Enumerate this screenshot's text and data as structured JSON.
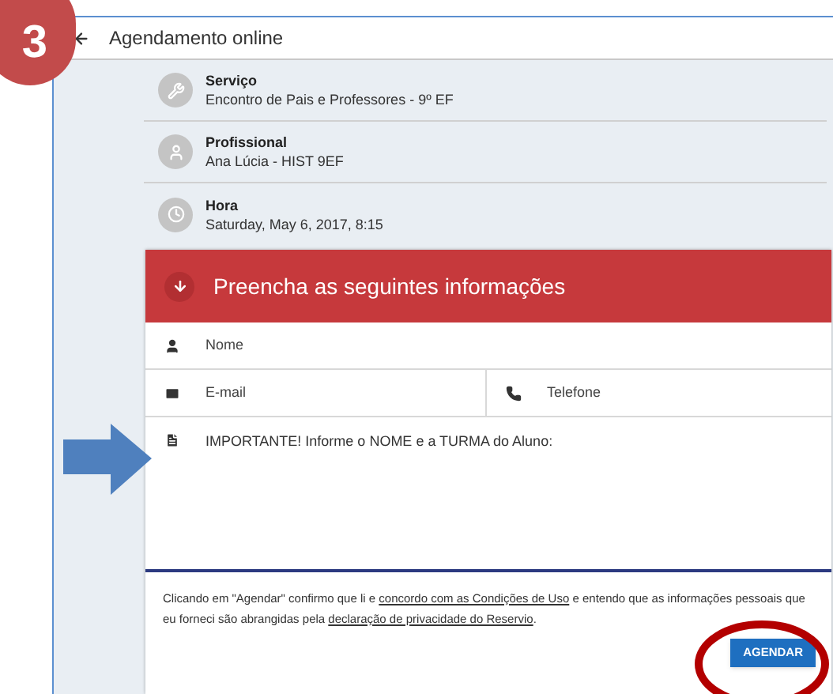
{
  "step_badge": "3",
  "header": {
    "title": "Agendamento online"
  },
  "summary": [
    {
      "kind": "service",
      "label": "Serviço",
      "value": "Encontro de Pais e Professores - 9º EF"
    },
    {
      "kind": "professional",
      "label": "Profissional",
      "value": "Ana Lúcia - HIST 9EF"
    },
    {
      "kind": "time",
      "label": "Hora",
      "value": "Saturday, May 6, 2017, 8:15"
    }
  ],
  "form": {
    "title": "Preencha as seguintes informações",
    "name": {
      "placeholder": "Nome"
    },
    "email": {
      "placeholder": "E-mail"
    },
    "phone": {
      "placeholder": "Telefone"
    },
    "notes": {
      "placeholder": "IMPORTANTE! Informe o NOME e a TURMA do Aluno:"
    },
    "consent": [
      {
        "kind": "text",
        "text": "Clicando em \"Agendar\" confirmo que li e "
      },
      {
        "kind": "link",
        "text": "concordo com as Condições de Uso"
      },
      {
        "kind": "text",
        "text": " e entendo que as informações pessoais que eu forneci são abrangidas pela "
      },
      {
        "kind": "link",
        "text": "declaração de privacidade do Reservio"
      },
      {
        "kind": "text",
        "text": "."
      }
    ],
    "submit": "AGENDAR"
  }
}
